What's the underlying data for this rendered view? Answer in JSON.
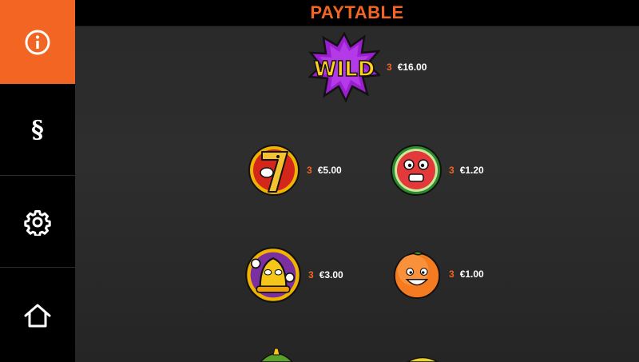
{
  "header": {
    "title": "PAYTABLE"
  },
  "sidebar": {
    "items": [
      {
        "name": "info",
        "icon": "info-icon",
        "active": true
      },
      {
        "name": "rules",
        "icon": "section-icon",
        "glyph": "§"
      },
      {
        "name": "settings",
        "icon": "gear-icon"
      },
      {
        "name": "home",
        "icon": "home-icon"
      }
    ]
  },
  "paytable": {
    "wild": {
      "symbol": "wild",
      "logo_text": "WILD",
      "count": "3",
      "payout": "€16.00"
    },
    "seven": {
      "symbol": "seven",
      "count": "3",
      "payout": "€5.00"
    },
    "watermelon": {
      "symbol": "watermelon",
      "count": "3",
      "payout": "€1.20"
    },
    "bell": {
      "symbol": "bell",
      "count": "3",
      "payout": "€3.00"
    },
    "orange": {
      "symbol": "orange",
      "count": "3",
      "payout": "€1.00"
    }
  },
  "colors": {
    "accent": "#f26522",
    "sidebar_bg": "#000000",
    "panel_bg": "#2e2e2e",
    "text": "#ffffff"
  }
}
